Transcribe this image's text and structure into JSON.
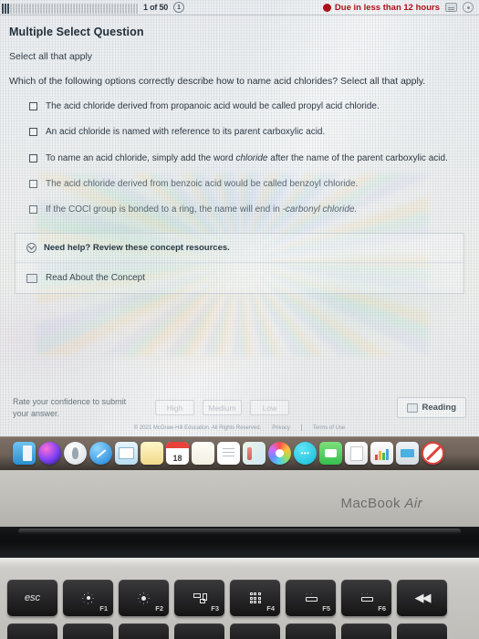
{
  "assignment_bar": {
    "progress_total_ticks": 50,
    "progress_done_ticks": 3,
    "position_label": "1 of 50",
    "question_badge": "1",
    "due_label": "Due in less than 12 hours",
    "icons": [
      "calculator-icon",
      "timer-icon"
    ]
  },
  "question": {
    "type_label": "Multiple Select Question",
    "instruction": "Select all that apply",
    "prompt": "Which of the following options correctly describe how to name acid chlorides? Select all that apply.",
    "options": [
      {
        "id": "opt-1",
        "checked": false,
        "faded": false,
        "parts": [
          {
            "text": "The acid chloride derived from propanoic acid would be called propyl acid chloride.",
            "italic": false
          }
        ]
      },
      {
        "id": "opt-2",
        "checked": false,
        "faded": false,
        "parts": [
          {
            "text": "An acid chloride is named with reference to its parent carboxylic acid.",
            "italic": false
          }
        ]
      },
      {
        "id": "opt-3",
        "checked": false,
        "faded": false,
        "parts": [
          {
            "text": "To name an acid chloride, simply add the word ",
            "italic": false
          },
          {
            "text": "chloride",
            "italic": true
          },
          {
            "text": " after the name of the parent carboxylic acid.",
            "italic": false
          }
        ]
      },
      {
        "id": "opt-4",
        "checked": false,
        "faded": true,
        "parts": [
          {
            "text": "The acid chloride derived from benzoic acid would be called benzoyl chloride.",
            "italic": false
          }
        ]
      },
      {
        "id": "opt-5",
        "checked": false,
        "faded": true,
        "parts": [
          {
            "text": "If the COCl group is bonded to a ring, the name will end in ",
            "italic": false
          },
          {
            "text": "-carbonyl chloride.",
            "italic": true
          }
        ]
      }
    ]
  },
  "help_panel": {
    "header": "Need help? Review these concept resources.",
    "chevron_icon": "chevron-down-circle-icon",
    "items": [
      {
        "icon": "book-icon",
        "label": "Read About the Concept"
      }
    ]
  },
  "confidence": {
    "prompt_line1": "Rate your confidence to submit",
    "prompt_line2": "your answer.",
    "buttons": [
      "High",
      "Medium",
      "Low"
    ],
    "reading_button": {
      "icon": "book-icon",
      "label": "Reading"
    }
  },
  "legal": {
    "copyright": "© 2021 McGraw-Hill Education. All Rights Reserved.",
    "privacy": "Privacy",
    "terms": "Terms of Use"
  },
  "dock": {
    "items": [
      {
        "name": "finder-icon",
        "class": "d-finder",
        "label": ""
      },
      {
        "name": "siri-icon",
        "class": "d-siri",
        "label": ""
      },
      {
        "name": "launchpad-icon",
        "class": "d-launch",
        "label": ""
      },
      {
        "name": "safari-icon",
        "class": "d-safari",
        "label": ""
      },
      {
        "name": "mail-icon",
        "class": "d-mail",
        "label": ""
      },
      {
        "name": "notes-icon",
        "class": "d-notes",
        "label": ""
      },
      {
        "name": "calendar-icon",
        "class": "d-cal",
        "label": "18"
      },
      {
        "name": "stickies-icon",
        "class": "d-blank",
        "label": ""
      },
      {
        "name": "reminders-icon",
        "class": "d-remind",
        "label": ""
      },
      {
        "name": "maps-icon",
        "class": "d-maps",
        "label": ""
      },
      {
        "name": "photos-icon",
        "class": "d-photos",
        "label": ""
      },
      {
        "name": "messages-icon",
        "class": "d-msg",
        "label": ""
      },
      {
        "name": "facetime-icon",
        "class": "d-facetime",
        "label": ""
      },
      {
        "name": "pages-icon",
        "class": "d-pages",
        "label": ""
      },
      {
        "name": "numbers-icon",
        "class": "d-numbers",
        "label": ""
      },
      {
        "name": "keynote-icon",
        "class": "d-keynote",
        "label": ""
      },
      {
        "name": "do-not-disturb-icon",
        "class": "d-none",
        "label": ""
      }
    ]
  },
  "hardware": {
    "model_name_bold": "MacBook",
    "model_name_italic": "Air",
    "keys": [
      {
        "name": "key-esc",
        "label": "esc",
        "fn": "",
        "glyph": "none"
      },
      {
        "name": "key-f1-brightness-down",
        "label": "",
        "fn": "F1",
        "glyph": "sun-small"
      },
      {
        "name": "key-f2-brightness-up",
        "label": "",
        "fn": "F2",
        "glyph": "sun-big"
      },
      {
        "name": "key-f3-mission-control",
        "label": "",
        "fn": "F3",
        "glyph": "mission-control"
      },
      {
        "name": "key-f4-launchpad",
        "label": "",
        "fn": "F4",
        "glyph": "grid"
      },
      {
        "name": "key-f5-keyboard-dim",
        "label": "",
        "fn": "F5",
        "glyph": "kb-dim"
      },
      {
        "name": "key-f6-keyboard-bright",
        "label": "",
        "fn": "F6",
        "glyph": "kb-bright"
      },
      {
        "name": "key-f7-rewind",
        "label": "",
        "fn": "",
        "glyph": "rewind"
      }
    ]
  }
}
